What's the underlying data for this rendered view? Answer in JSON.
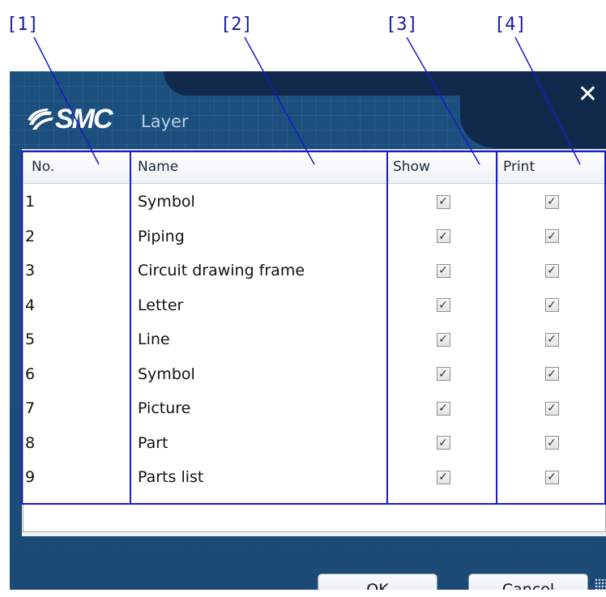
{
  "callouts": [
    "[1]",
    "[2]",
    "[3]",
    "[4]"
  ],
  "window": {
    "brand": "SMC",
    "title": "Layer",
    "close_icon": "close-icon"
  },
  "table": {
    "headers": {
      "no": "No.",
      "name": "Name",
      "show": "Show",
      "print": "Print"
    },
    "rows": [
      {
        "no": "1",
        "name": "Symbol",
        "show": true,
        "print": true
      },
      {
        "no": "2",
        "name": "Piping",
        "show": true,
        "print": true
      },
      {
        "no": "3",
        "name": "Circuit drawing frame",
        "show": true,
        "print": true
      },
      {
        "no": "4",
        "name": "Letter",
        "show": true,
        "print": true
      },
      {
        "no": "5",
        "name": "Line",
        "show": true,
        "print": true
      },
      {
        "no": "6",
        "name": "Symbol",
        "show": true,
        "print": true
      },
      {
        "no": "7",
        "name": "Picture",
        "show": true,
        "print": true
      },
      {
        "no": "8",
        "name": "Part",
        "show": true,
        "print": true
      },
      {
        "no": "9",
        "name": "Parts list",
        "show": true,
        "print": true
      }
    ]
  },
  "buttons": {
    "ok": "OK",
    "cancel": "Cancel"
  },
  "colors": {
    "window_bg": "#1b4d7a",
    "callout": "#1a1ad0"
  }
}
